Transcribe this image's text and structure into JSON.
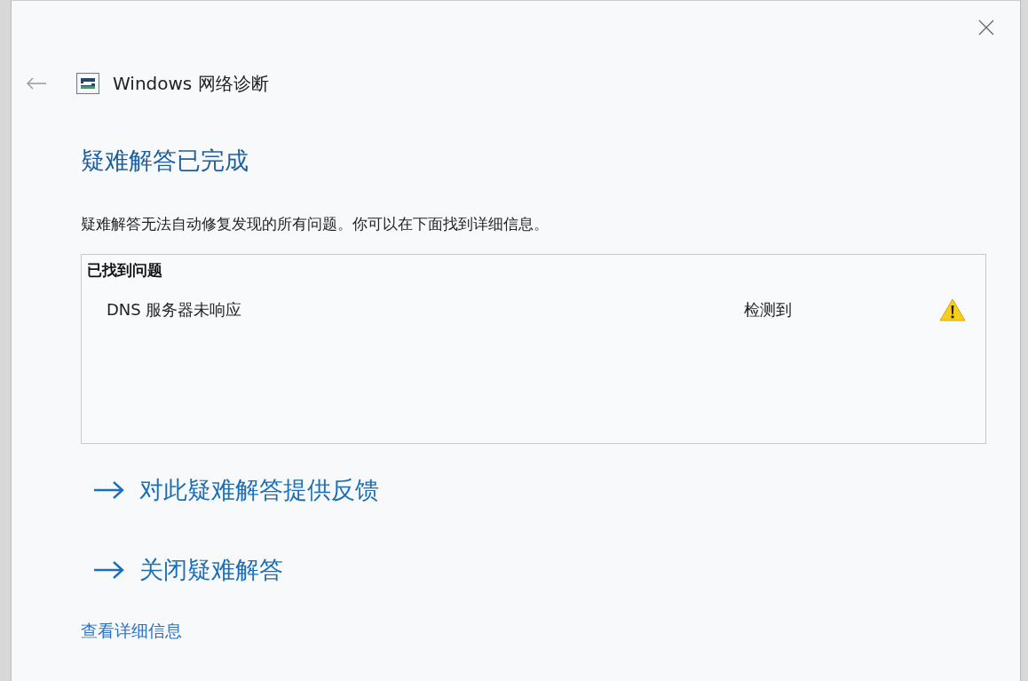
{
  "window": {
    "title": "Windows 网络诊断"
  },
  "heading": "疑难解答已完成",
  "description": "疑难解答无法自动修复发现的所有问题。你可以在下面找到详细信息。",
  "problems": {
    "title": "已找到问题",
    "rows": [
      {
        "name": "DNS 服务器未响应",
        "status": "检测到",
        "kind": "warning"
      }
    ]
  },
  "actions": [
    {
      "label": "对此疑难解答提供反馈"
    },
    {
      "label": "关闭疑难解答"
    }
  ],
  "details_link": "查看详细信息"
}
